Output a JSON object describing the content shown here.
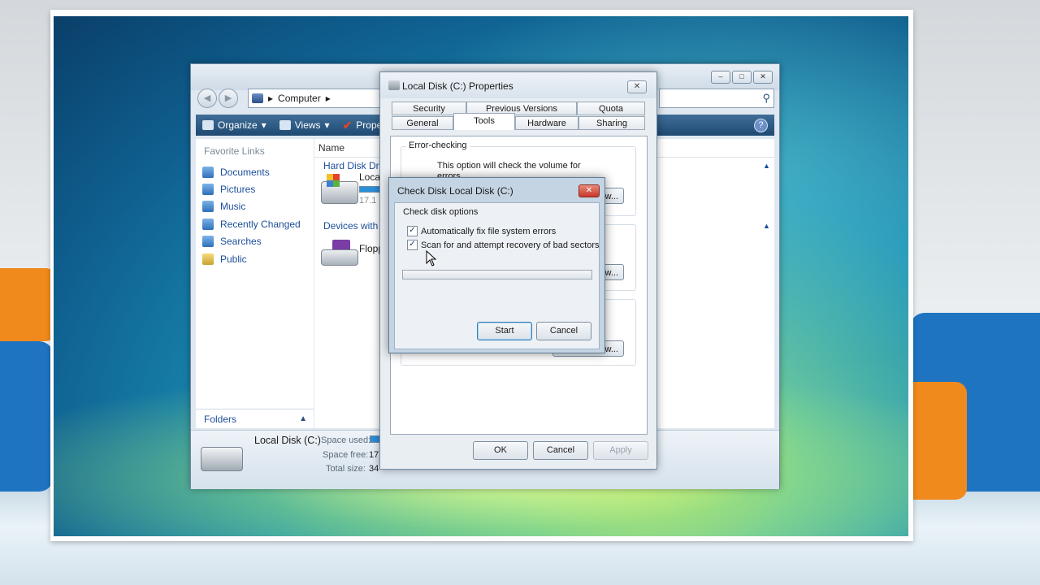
{
  "explorer": {
    "address": "Computer",
    "toolbar": {
      "organize": "Organize",
      "views": "Views",
      "properties": "Proper"
    },
    "favorite_links_header": "Favorite Links",
    "favorites": [
      "Documents",
      "Pictures",
      "Music",
      "Recently Changed",
      "Searches",
      "Public"
    ],
    "folders_label": "Folders",
    "column_name": "Name",
    "groups": {
      "hard_disk": "Hard Disk Drive",
      "removable": "Devices with R"
    },
    "items": {
      "local_disk": "Local",
      "local_disk_free": "17.1",
      "floppy": "Flopp"
    },
    "details": {
      "name": "Local Disk (C:)",
      "space_used_label": "Space used:",
      "space_free_label": "Space free:",
      "space_free_value": "17.",
      "total_size_label": "Total size:",
      "total_size_value": "34"
    }
  },
  "properties": {
    "title": "Local Disk (C:) Properties",
    "tabs_top": [
      "Security",
      "Previous Versions",
      "Quota"
    ],
    "tabs_bottom": [
      "General",
      "Tools",
      "Hardware",
      "Sharing"
    ],
    "active_tab": "Tools",
    "error_checking_label": "Error-checking",
    "error_checking_text": "This option will check the volume for",
    "error_checking_text2": "errors.",
    "check_now_partial": "w...",
    "defrag_partial": "w...",
    "backup_partial": "w...",
    "buttons": {
      "ok": "OK",
      "cancel": "Cancel",
      "apply": "Apply"
    }
  },
  "check_disk": {
    "title": "Check Disk Local Disk (C:)",
    "group_label": "Check disk options",
    "option_fix": "Automatically fix file system errors",
    "option_scan": "Scan for and attempt recovery of bad sectors",
    "option_fix_checked": true,
    "option_scan_checked": true,
    "progress": 0,
    "start": "Start",
    "cancel": "Cancel"
  },
  "window_buttons": {
    "minimize": "–",
    "maximize": "□",
    "close": "✕"
  },
  "colors": {
    "toolbar": "#2b5883",
    "link": "#1b4e9a",
    "accent_orange": "#f08a1c",
    "accent_blue": "#1f74c2"
  }
}
